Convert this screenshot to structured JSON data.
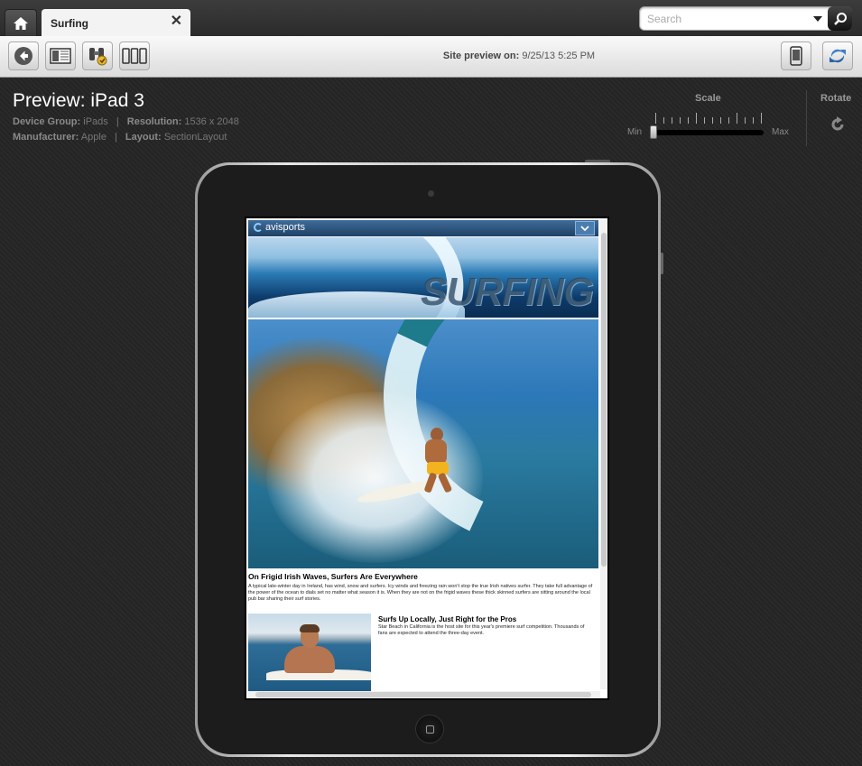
{
  "tabbar": {
    "tab_title": "Surfing",
    "close_glyph": "✕",
    "search_placeholder": "Search"
  },
  "toolbar": {
    "site_preview_label": "Site preview on:",
    "site_preview_value": "9/25/13 5:25 PM",
    "icons": [
      "back-arrow-icon",
      "page-layout-icon",
      "binoculars-icon",
      "devices-icon",
      "mobile-device-icon",
      "sync-icon"
    ]
  },
  "preview": {
    "title": "Preview: iPad 3",
    "device_group_label": "Device Group:",
    "device_group_value": "iPads",
    "resolution_label": "Resolution:",
    "resolution_value": "1536 x 2048",
    "manufacturer_label": "Manufacturer:",
    "manufacturer_value": "Apple",
    "layout_label": "Layout:",
    "layout_value": "SectionLayout",
    "separator": "|"
  },
  "scale": {
    "label": "Scale",
    "min_label": "Min",
    "max_label": "Max",
    "level": 0
  },
  "rotate": {
    "label": "Rotate"
  },
  "site": {
    "logo_text": "avisports",
    "banner_word": "SURFING",
    "article1": {
      "title": "On Frigid Irish Waves, Surfers Are Everywhere",
      "text": "A typical late-winter day in Ireland, has wind, snow and surfers. Icy winds and freezing rain won't stop the true Irish natives surfer. They take full advantage of the power of the ocean to dials set no matter what season it is. When they are not on the frigid waves these thick skinned surfers are sitting around the local pub bar sharing their surf stories."
    },
    "article2": {
      "title": "Surfs Up Locally, Just Right for the Pros",
      "text": "Star Beach in California is the host site for this year's premiere surf competition. Thousands of fans are expected to attend the three-day event."
    }
  },
  "colors": {
    "accent_blue": "#2f5f92",
    "background": "#262626"
  }
}
